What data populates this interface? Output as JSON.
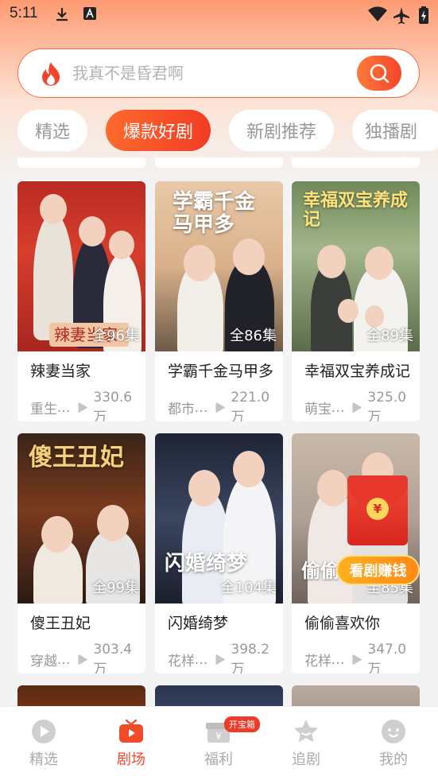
{
  "status_bar": {
    "time": "5:11"
  },
  "search": {
    "placeholder": "我真不是昏君啊"
  },
  "tabs": [
    {
      "label": "精选"
    },
    {
      "label": "爆款好剧",
      "active": true
    },
    {
      "label": "新剧推荐"
    },
    {
      "label": "独播剧"
    }
  ],
  "dramas": [
    {
      "poster_text": "辣妻当家",
      "episodes": "全96集",
      "title": "辣妻当家",
      "tag": "重生",
      "views": "330.6万"
    },
    {
      "poster_text": "学霸千金马甲多",
      "episodes": "全86集",
      "title": "学霸千金马甲多",
      "tag": "都市",
      "views": "221.0万"
    },
    {
      "poster_text": "幸福双宝养成记",
      "episodes": "全89集",
      "title": "幸福双宝养成记",
      "tag": "萌宝",
      "views": "325.0万"
    },
    {
      "poster_text": "傻王丑妃",
      "episodes": "全99集",
      "title": "傻王丑妃",
      "tag": "穿越",
      "views": "303.4万"
    },
    {
      "poster_text": "闪婚绮梦",
      "episodes": "全104集",
      "title": "闪婚绮梦",
      "tag": "花样",
      "views": "398.2万"
    },
    {
      "poster_text": "偷偷喜欢你",
      "episodes": "全85集",
      "title": "偷偷喜欢你",
      "tag": "花样",
      "views": "347.0万"
    }
  ],
  "red_packet": {
    "button_label": "看剧赚钱",
    "coin_symbol": "¥"
  },
  "bottom_nav": {
    "items": [
      {
        "label": "精选",
        "icon": "play-circle-icon"
      },
      {
        "label": "剧场",
        "icon": "tv-icon",
        "active": true
      },
      {
        "label": "福利",
        "icon": "gift-icon",
        "badge": "开宝箱"
      },
      {
        "label": "追剧",
        "icon": "star-icon"
      },
      {
        "label": "我的",
        "icon": "profile-icon"
      }
    ]
  },
  "colors": {
    "accent": "#f04a2a",
    "accent_gradient_start": "#fe6a2e",
    "inactive": "#aaaaaa"
  }
}
